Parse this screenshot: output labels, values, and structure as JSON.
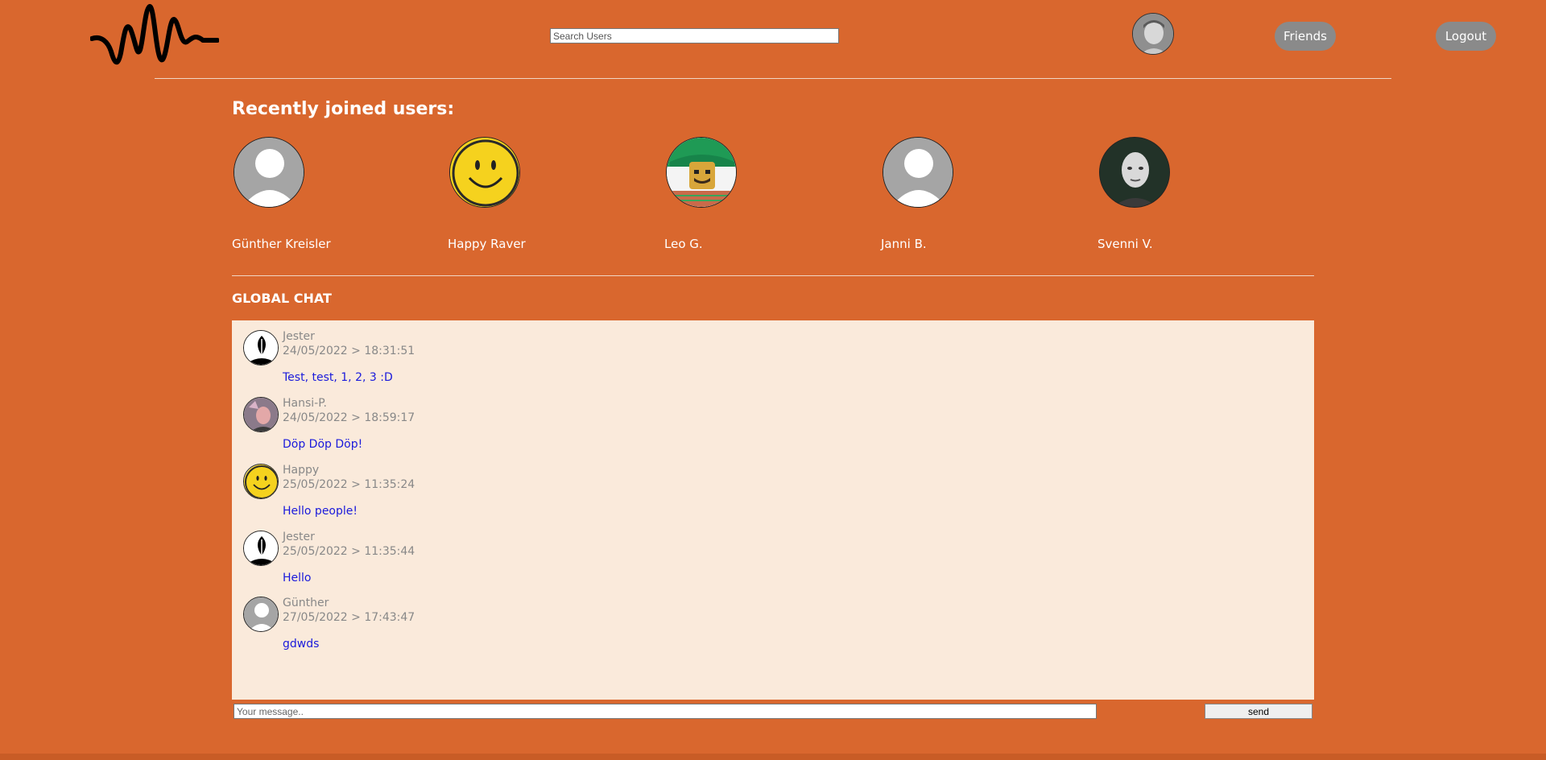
{
  "header": {
    "logo": "soundwave-logo",
    "search_placeholder": "Search Users",
    "friends_label": "Friends",
    "logout_label": "Logout"
  },
  "recent": {
    "title": "Recently joined users:",
    "users": [
      {
        "name": "Günther Kreisler",
        "avatar": "default-avatar"
      },
      {
        "name": "Happy Raver",
        "avatar": "smiley"
      },
      {
        "name": "Leo G.",
        "avatar": "lego-figure"
      },
      {
        "name": "Janni B.",
        "avatar": "default-avatar"
      },
      {
        "name": "Svenni V.",
        "avatar": "photo"
      }
    ]
  },
  "chat": {
    "title": "GLOBAL CHAT",
    "messages": [
      {
        "user": "Jester",
        "time": "24/05/2022 > 18:31:51",
        "text": "Test, test, 1, 2, 3 :D",
        "avatar": "jester"
      },
      {
        "user": "Hansi-P.",
        "time": "24/05/2022 > 18:59:17",
        "text": "Döp Döp Döp!",
        "avatar": "photo"
      },
      {
        "user": "Happy",
        "time": "25/05/2022 > 11:35:24",
        "text": "Hello people!",
        "avatar": "smiley"
      },
      {
        "user": "Jester",
        "time": "25/05/2022 > 11:35:44",
        "text": "Hello",
        "avatar": "jester"
      },
      {
        "user": "Günther",
        "time": "27/05/2022 > 17:43:47",
        "text": "gdwds",
        "avatar": "default-avatar"
      }
    ],
    "input_placeholder": "Your message..",
    "send_label": "send"
  },
  "colors": {
    "background": "#d9672e",
    "chat_background": "#faeadb",
    "message_text": "#1a1adb",
    "pill": "#8a8a8a"
  }
}
